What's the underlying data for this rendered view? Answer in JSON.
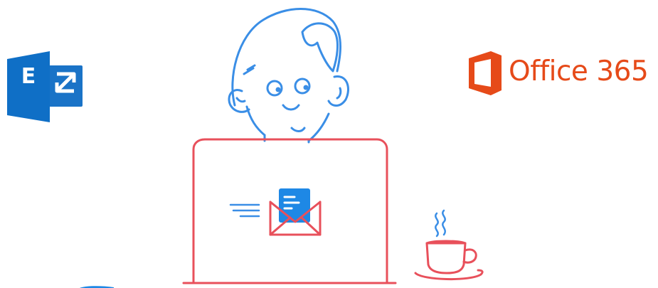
{
  "logos": {
    "exchange": {
      "letter": "E",
      "color": "#0f6fc6",
      "icon": "exchange-logo-icon"
    },
    "office365": {
      "text": "Office 365",
      "color": "#e64a19",
      "icon": "office-logo-icon"
    }
  },
  "illustration": {
    "person_color": "#3a8ee6",
    "laptop_color": "#e8505b",
    "envelope_letter_color": "#1e88e5",
    "icons": [
      "person-icon",
      "laptop-icon",
      "envelope-icon",
      "coffee-cup-icon",
      "steam-icon"
    ]
  }
}
